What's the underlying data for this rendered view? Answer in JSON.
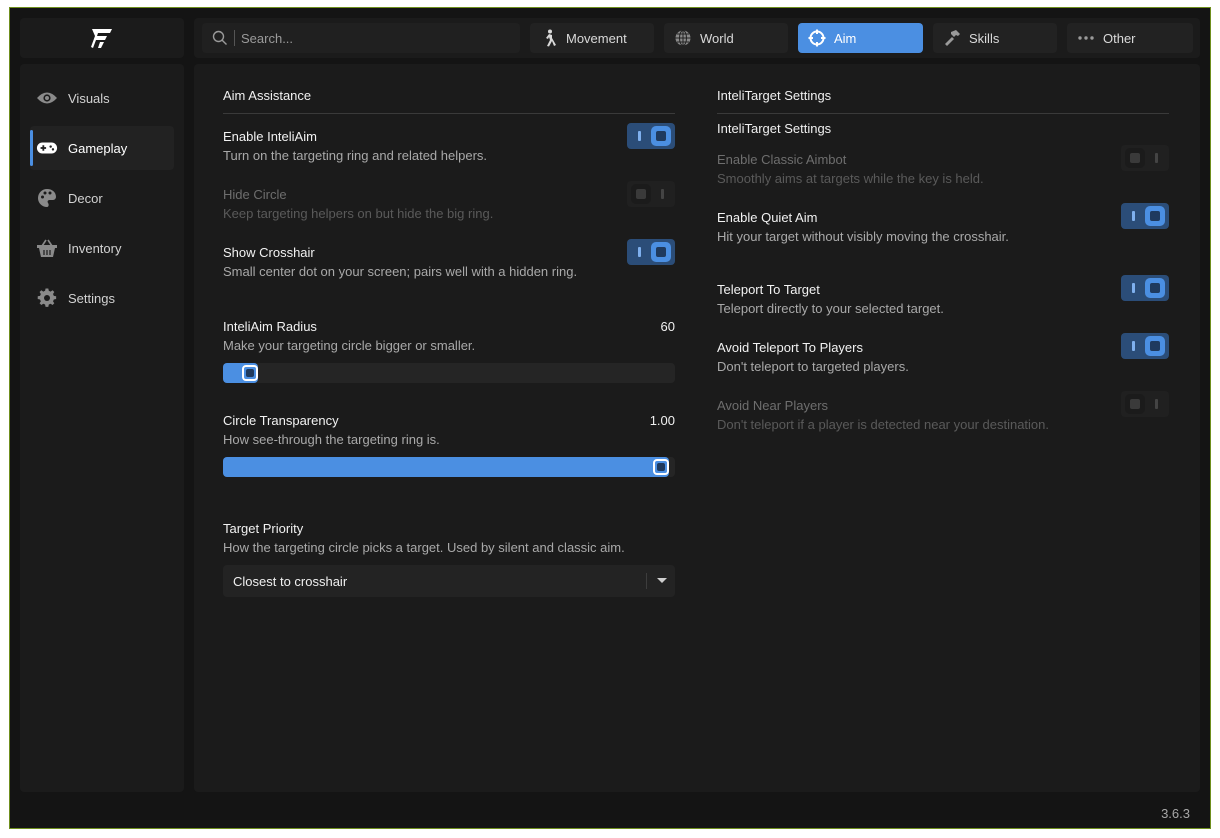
{
  "app": {
    "version": "3.6.3"
  },
  "search": {
    "placeholder": "Search..."
  },
  "tabs": [
    {
      "label": "Movement",
      "icon": "walking-person-icon",
      "active": false
    },
    {
      "label": "World",
      "icon": "globe-icon",
      "active": false
    },
    {
      "label": "Aim",
      "icon": "crosshair-icon",
      "active": true
    },
    {
      "label": "Skills",
      "icon": "hammer-icon",
      "active": false
    },
    {
      "label": "Other",
      "icon": "ellipsis-icon",
      "active": false
    }
  ],
  "sidebar": {
    "items": [
      {
        "label": "Visuals",
        "icon": "eye-icon",
        "active": false
      },
      {
        "label": "Gameplay",
        "icon": "gamepad-icon",
        "active": true
      },
      {
        "label": "Decor",
        "icon": "palette-icon",
        "active": false
      },
      {
        "label": "Inventory",
        "icon": "basket-icon",
        "active": false
      },
      {
        "label": "Settings",
        "icon": "gear-icon",
        "active": false
      }
    ]
  },
  "left": {
    "title": "Aim Assistance",
    "toggles": [
      {
        "label": "Enable InteliAim",
        "desc": "Turn on the targeting ring and related helpers.",
        "on": true,
        "disabled": false
      },
      {
        "label": "Hide Circle",
        "desc": "Keep targeting helpers on but hide the big ring.",
        "on": false,
        "disabled": true
      },
      {
        "label": "Show Crosshair",
        "desc": "Small center dot on your screen; pairs well with a hidden ring.",
        "on": true,
        "disabled": false
      }
    ],
    "sliders": [
      {
        "label": "InteliAim Radius",
        "desc": "Make your targeting circle bigger or smaller.",
        "value_text": "60",
        "fraction": 0.04
      },
      {
        "label": "Circle Transparency",
        "desc": "How see-through the targeting ring is.",
        "value_text": "1.00",
        "fraction": 1.0
      }
    ],
    "priority": {
      "label": "Target Priority",
      "desc": "How the targeting circle picks a target. Used by silent and classic aim.",
      "selected": "Closest to crosshair"
    }
  },
  "right": {
    "title": "InteliTarget Settings",
    "subtitle": "InteliTarget Settings",
    "toggles": [
      {
        "label": "Enable Classic Aimbot",
        "desc": "Smoothly aims at targets while the key is held.",
        "on": false,
        "disabled": true
      },
      {
        "label": "Enable Quiet Aim",
        "desc": "Hit your target without visibly moving the crosshair.",
        "on": true,
        "disabled": false
      },
      {
        "label": "Teleport To Target",
        "desc": "Teleport directly to your selected target.",
        "on": true,
        "disabled": false
      },
      {
        "label": "Avoid Teleport To Players",
        "desc": "Don't teleport to targeted players.",
        "on": true,
        "disabled": false
      },
      {
        "label": "Avoid Near Players",
        "desc": "Don't teleport if a player is detected near your destination.",
        "on": false,
        "disabled": true
      }
    ]
  },
  "colors": {
    "accent": "#4b8fe2",
    "background": "#141414",
    "panel": "#1b1b1b"
  }
}
